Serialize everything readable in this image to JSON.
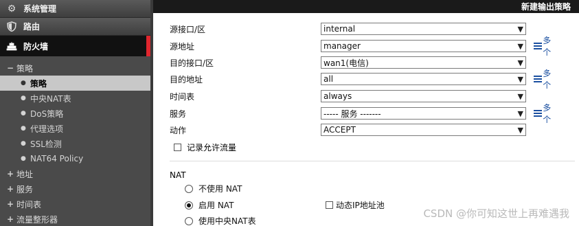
{
  "sidebar": {
    "top_items": [
      {
        "label": "系统管理",
        "icon": "gear-icon"
      },
      {
        "label": "路由",
        "icon": "shield-icon"
      }
    ],
    "active_item": {
      "label": "防火墙",
      "icon": "firewall-icon"
    },
    "policy_group": {
      "sign": "−",
      "label": "策略"
    },
    "policy_items": [
      {
        "label": "策略"
      },
      {
        "label": "中央NAT表"
      },
      {
        "label": "DoS策略"
      },
      {
        "label": "代理选项"
      },
      {
        "label": "SSL检测"
      },
      {
        "label": "NAT64 Policy"
      }
    ],
    "groups": [
      {
        "sign": "+",
        "label": "地址"
      },
      {
        "sign": "+",
        "label": "服务"
      },
      {
        "sign": "+",
        "label": "时间表"
      },
      {
        "sign": "+",
        "label": "流量整形器"
      }
    ]
  },
  "main": {
    "title": "新建输出策略",
    "fields": [
      {
        "label": "源接口/区",
        "value": "internal"
      },
      {
        "label": "源地址",
        "value": "manager",
        "more": "多个"
      },
      {
        "label": "目的接口/区",
        "value": "wan1(电信)"
      },
      {
        "label": "目的地址",
        "value": "all",
        "more": "多个"
      },
      {
        "label": "时间表",
        "value": "always"
      },
      {
        "label": "服务",
        "value": "----- 服务 -------",
        "more": "多个"
      },
      {
        "label": "动作",
        "value": "ACCEPT"
      }
    ],
    "log_allowed": "记录允许流量",
    "nat": {
      "heading": "NAT",
      "options": [
        {
          "label": "不使用 NAT",
          "checked": false
        },
        {
          "label": "启用 NAT",
          "checked": true
        },
        {
          "label": "使用中央NAT表",
          "checked": false
        }
      ],
      "dynamic_pool": "动态IP地址池"
    }
  },
  "watermark": "CSDN @你可知这世上再难遇我",
  "colors": {
    "accent": "#e0262e",
    "link": "#1a4fa0",
    "sidebar_bg": "#4a4a4a"
  }
}
